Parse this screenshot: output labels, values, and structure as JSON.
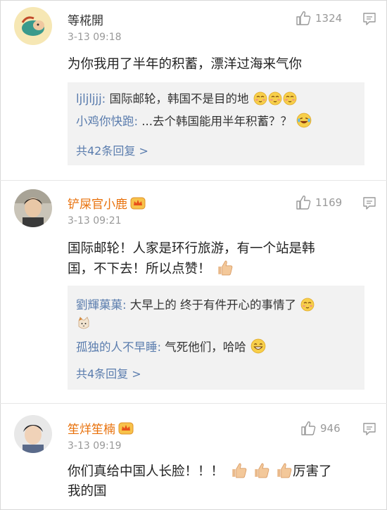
{
  "comments": [
    {
      "username": "等椛開",
      "time": "3-13 09:18",
      "likes": "1324",
      "text": "为你我用了半年的积蓄，漂洋过海来气你",
      "replies": [
        {
          "name": "ljljljjj:",
          "text": " 国际邮轮，韩国不是目的地"
        },
        {
          "name": "小鸡你快跑:",
          "text": " ...去个韩国能用半年积蓄？？"
        }
      ],
      "more": "共42条回复 >"
    },
    {
      "username": "铲屎官小鹿",
      "time": "3-13 09:21",
      "likes": "1169",
      "text_lines": [
        "国际邮轮！人家是环行旅游，有一个站是韩",
        "国，不下去！所以点赞！"
      ],
      "replies": [
        {
          "name": "劉輝菓菓:",
          "text": " 大早上的 终于有件开心的事情了"
        },
        {
          "name": "孤独的人不早睡:",
          "text": " 气死他们，哈哈"
        }
      ],
      "more": "共4条回复 >"
    },
    {
      "username": "笙烊笙楠",
      "time": "3-13 09:19",
      "likes": "946",
      "text_lines": [
        "你们真给中国人长脸！！！",
        "我的国"
      ],
      "text_suffix": "厉害了"
    }
  ],
  "colors": {
    "username_orange": "#e8700a",
    "reply_name": "#5b7dae",
    "meta_grey": "#999999",
    "reply_bg": "#f2f2f2"
  },
  "icons": [
    "thumb-up-icon",
    "comment-icon",
    "vip-crown-icon",
    "shy-face-emoji",
    "laugh-cry-emoji",
    "thumbs-up-emoji",
    "grin-emoji",
    "cat-emoji"
  ]
}
